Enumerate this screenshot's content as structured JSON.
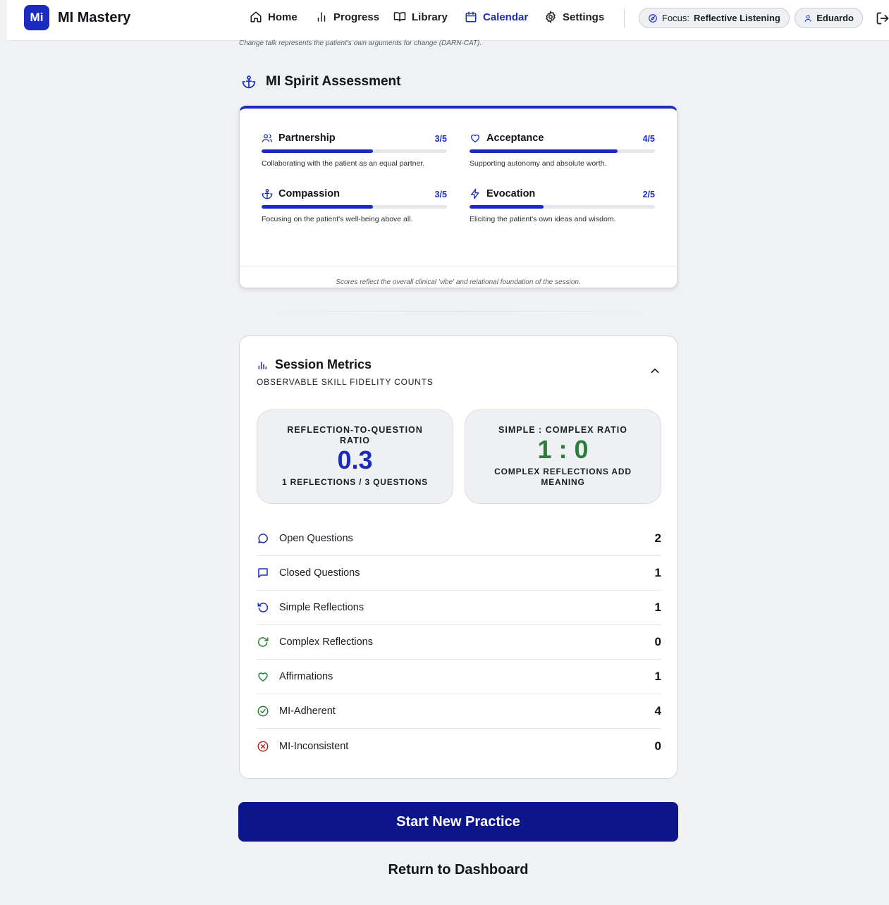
{
  "app": {
    "logo": "Mi",
    "name": "MI Mastery"
  },
  "nav": {
    "items": [
      {
        "label": "Home",
        "icon": "home-icon"
      },
      {
        "label": "Progress",
        "icon": "bar-chart-icon"
      },
      {
        "label": "Library",
        "icon": "book-icon"
      },
      {
        "label": "Calendar",
        "icon": "calendar-icon"
      },
      {
        "label": "Settings",
        "icon": "gear-icon"
      }
    ],
    "active": "Calendar",
    "focus_prefix": "Focus:",
    "focus_value": "Reflective Listening",
    "user": "Eduardo"
  },
  "caption_top": "Change talk represents the patient's own arguments for change (DARN-CAT).",
  "spirit": {
    "title": "MI Spirit Assessment",
    "items": [
      {
        "name": "Partnership",
        "score": "3/5",
        "value": 3,
        "max": 5,
        "desc": "Collaborating with the patient as an equal partner."
      },
      {
        "name": "Acceptance",
        "score": "4/5",
        "value": 4,
        "max": 5,
        "desc": "Supporting autonomy and absolute worth."
      },
      {
        "name": "Compassion",
        "score": "3/5",
        "value": 3,
        "max": 5,
        "desc": "Focusing on the patient's well-being above all."
      },
      {
        "name": "Evocation",
        "score": "2/5",
        "value": 2,
        "max": 5,
        "desc": "Eliciting the patient's own ideas and wisdom."
      }
    ],
    "footnote": "Scores reflect the overall clinical 'vibe' and relational foundation of the session."
  },
  "metrics": {
    "title": "Session Metrics",
    "subtitle": "OBSERVABLE SKILL FIDELITY COUNTS",
    "ratio1": {
      "label": "REFLECTION-TO-QUESTION RATIO",
      "value": "0.3",
      "note": "1 REFLECTIONS / 3 QUESTIONS"
    },
    "ratio2": {
      "label": "SIMPLE : COMPLEX RATIO",
      "value": "1 : 0",
      "note": "COMPLEX REFLECTIONS ADD MEANING"
    },
    "counts": [
      {
        "label": "Open Questions",
        "value": "2"
      },
      {
        "label": "Closed Questions",
        "value": "1"
      },
      {
        "label": "Simple Reflections",
        "value": "1"
      },
      {
        "label": "Complex Reflections",
        "value": "0"
      },
      {
        "label": "Affirmations",
        "value": "1"
      },
      {
        "label": "MI-Adherent",
        "value": "4"
      },
      {
        "label": "MI-Inconsistent",
        "value": "0"
      }
    ]
  },
  "actions": {
    "primary": "Start New Practice",
    "secondary": "Return to Dashboard"
  },
  "colors": {
    "primary": "#1c2bbf",
    "button": "#0d158a",
    "green": "#2e7d3b",
    "red": "#b3261e"
  }
}
